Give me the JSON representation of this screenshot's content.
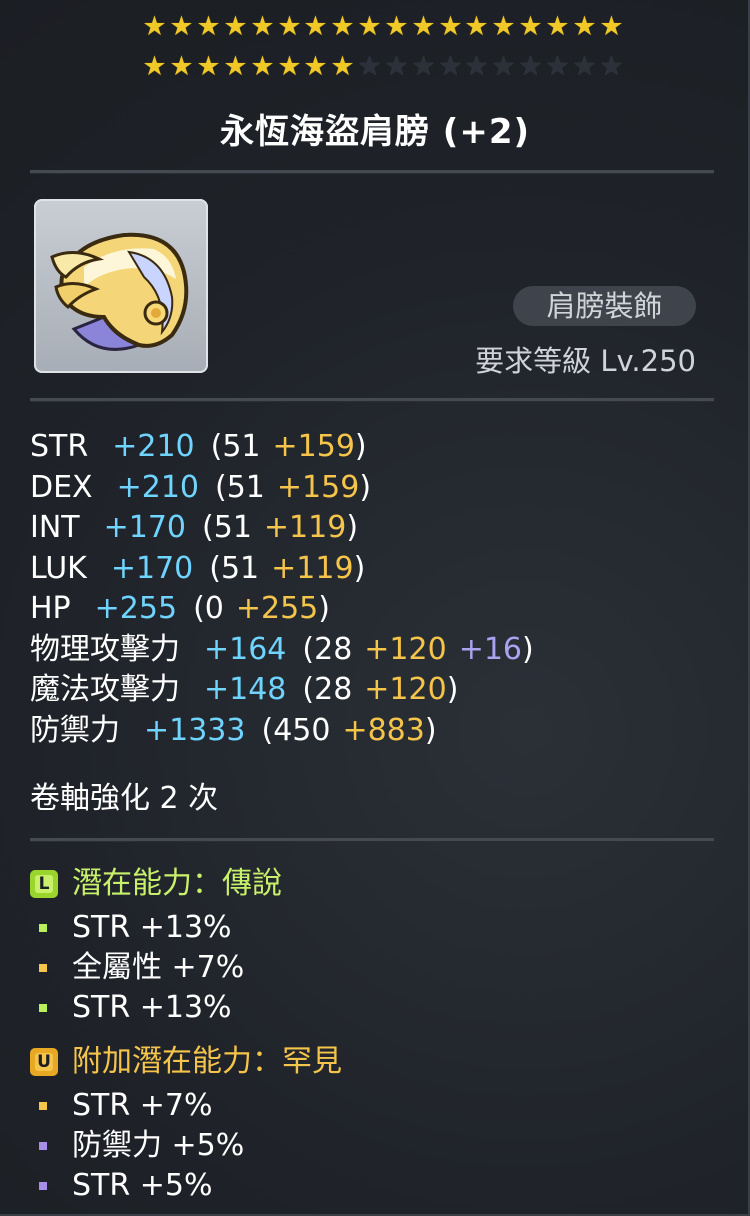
{
  "stars": {
    "row1": [
      6,
      6,
      6
    ],
    "row2": [
      6,
      2,
      0
    ],
    "per_group": 6
  },
  "title": "永恆海盜肩膀 (+2)",
  "item": {
    "category": "肩膀裝飾",
    "requirement": "要求等級 Lv.250"
  },
  "stats": [
    {
      "name": "STR",
      "total": "+210",
      "open": "(51",
      "base": "",
      "gold": "+159",
      "purple": "",
      "close": ")"
    },
    {
      "name": "DEX",
      "total": "+210",
      "open": "(51",
      "gold": "+159",
      "purple": "",
      "close": ")"
    },
    {
      "name": "INT",
      "total": "+170",
      "open": "(51",
      "gold": "+119",
      "purple": "",
      "close": ")"
    },
    {
      "name": "LUK",
      "total": "+170",
      "open": "(51",
      "gold": "+119",
      "purple": "",
      "close": ")"
    },
    {
      "name": "HP",
      "total": "+255",
      "open": "(0",
      "gold": "+255",
      "purple": "",
      "close": ")"
    },
    {
      "name": "物理攻擊力",
      "total": "+164",
      "open": "(28",
      "gold": "+120",
      "purple": "+16",
      "close": ")"
    },
    {
      "name": "魔法攻擊力",
      "total": "+148",
      "open": "(28",
      "gold": "+120",
      "purple": "",
      "close": ")"
    },
    {
      "name": "防禦力",
      "total": "+1333",
      "open": "(450",
      "gold": "+883",
      "purple": "",
      "close": ")"
    }
  ],
  "scroll_text": "卷軸強化 2 次",
  "potential": {
    "icon_letter": "L",
    "title": "潛在能力：傳說",
    "color": "#c8f06a",
    "lines": [
      {
        "text": "STR +13%",
        "bullet": "#b7f05a"
      },
      {
        "text": "全屬性 +7%",
        "bullet": "#f5c44a"
      },
      {
        "text": "STR +13%",
        "bullet": "#b7f05a"
      }
    ]
  },
  "additional": {
    "icon_letter": "U",
    "title": "附加潛在能力：罕見",
    "color": "#f5c44a",
    "lines": [
      {
        "text": "STR +7%",
        "bullet": "#f5c44a"
      },
      {
        "text": "防禦力 +5%",
        "bullet": "#a78ee8"
      },
      {
        "text": "STR +5%",
        "bullet": "#a78ee8"
      }
    ]
  }
}
